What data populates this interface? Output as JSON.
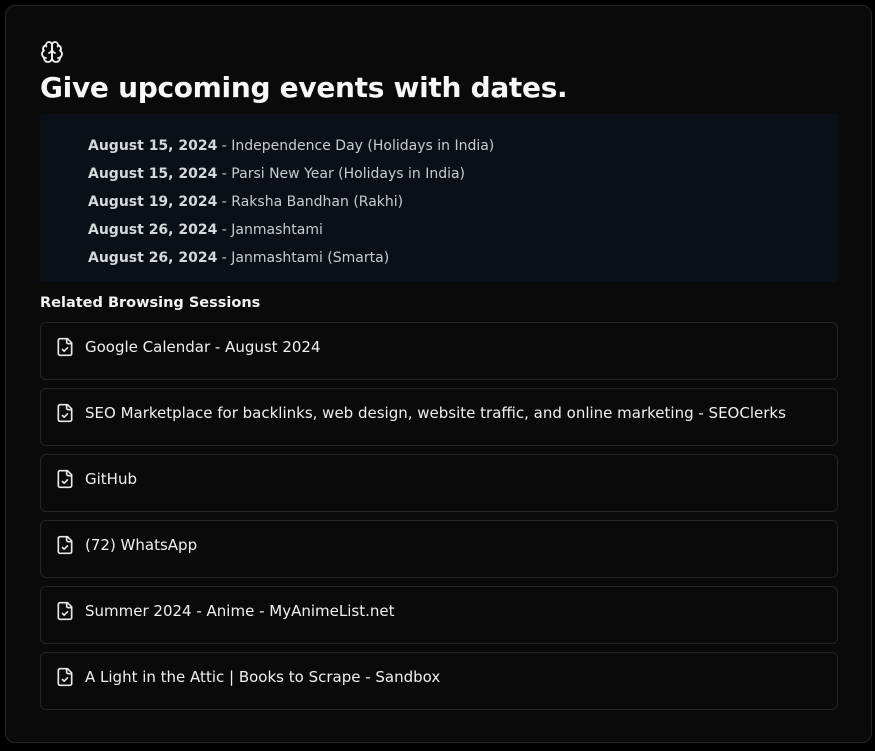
{
  "title": "Give upcoming events with dates.",
  "events": [
    {
      "date": "August 15, 2024",
      "name": "Independence Day (Holidays in India)"
    },
    {
      "date": "August 15, 2024",
      "name": "Parsi New Year (Holidays in India)"
    },
    {
      "date": "August 19, 2024",
      "name": "Raksha Bandhan (Rakhi)"
    },
    {
      "date": "August 26, 2024",
      "name": "Janmashtami"
    },
    {
      "date": "August 26, 2024",
      "name": "Janmashtami (Smarta)"
    }
  ],
  "separator": " - ",
  "related_heading": "Related Browsing Sessions",
  "sessions": [
    "Google Calendar - August 2024",
    "SEO Marketplace for backlinks, web design, website traffic, and online marketing - SEOClerks",
    "GitHub",
    "(72) WhatsApp",
    "Summer 2024 - Anime - MyAnimeList.net",
    "A Light in the Attic | Books to Scrape - Sandbox"
  ],
  "icons": {
    "header": "brain-icon",
    "session": "file-check-icon"
  },
  "colors": {
    "background": "#0a0a0a",
    "answer_background": "#0b0f17",
    "border": "#262626",
    "text": "#f0f0f0"
  }
}
